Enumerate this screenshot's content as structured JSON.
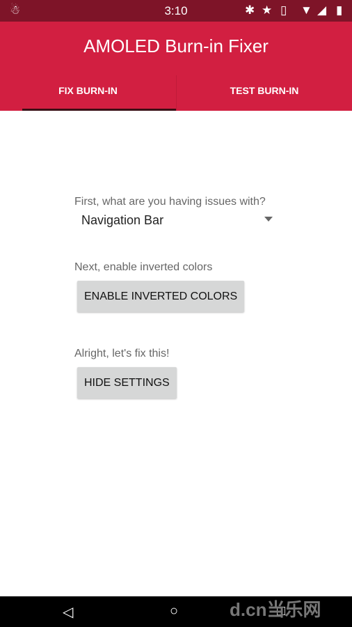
{
  "status_bar": {
    "time": "3:10",
    "icons": [
      "android-debug-icon",
      "bluetooth-icon",
      "star-icon",
      "vibrate-icon",
      "wifi-icon",
      "signal-icon",
      "battery-charging-icon"
    ]
  },
  "app_bar": {
    "title": "AMOLED Burn-in Fixer",
    "tabs": [
      {
        "label": "FIX BURN-IN",
        "selected": true
      },
      {
        "label": "TEST BURN-IN",
        "selected": false
      }
    ]
  },
  "main": {
    "question_label": "First, what are you having issues with?",
    "issue_select": {
      "value": "Navigation Bar"
    },
    "invert_label": "Next, enable inverted colors",
    "invert_button": "ENABLE INVERTED COLORS",
    "fix_label": "Alright, let's fix this!",
    "hide_button": "HIDE SETTINGS"
  },
  "colors": {
    "primary": "#d21f41",
    "status_bar": "#7e1428",
    "button": "#d6d7d7"
  },
  "watermark": "d.cn当乐网"
}
